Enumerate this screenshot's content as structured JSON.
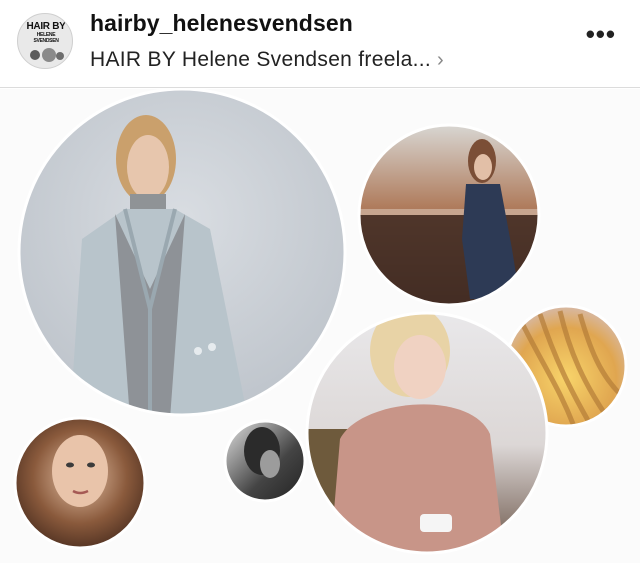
{
  "profile": {
    "username": "hairby_helenesvendsen",
    "subtitle": "HAIR BY Helene Svendsen freela...",
    "chevron": "›",
    "more_icon": "•••",
    "avatar_logo_line1": "HAIR BY",
    "avatar_logo_line2": "HELENE SVENDSEN"
  },
  "colors": {
    "background": "#ffffff",
    "header_border": "#dcdcdc",
    "text_primary": "#111111",
    "chevron": "#888888"
  },
  "post": {
    "photos": [
      {
        "name": "model-grey-coat-photo"
      },
      {
        "name": "model-river-railing-photo"
      },
      {
        "name": "braided-hair-photo"
      },
      {
        "name": "blonde-woman-pink-sweater-photo"
      },
      {
        "name": "model-wavy-hair-portrait-photo"
      },
      {
        "name": "black-white-portrait-photo"
      }
    ]
  }
}
